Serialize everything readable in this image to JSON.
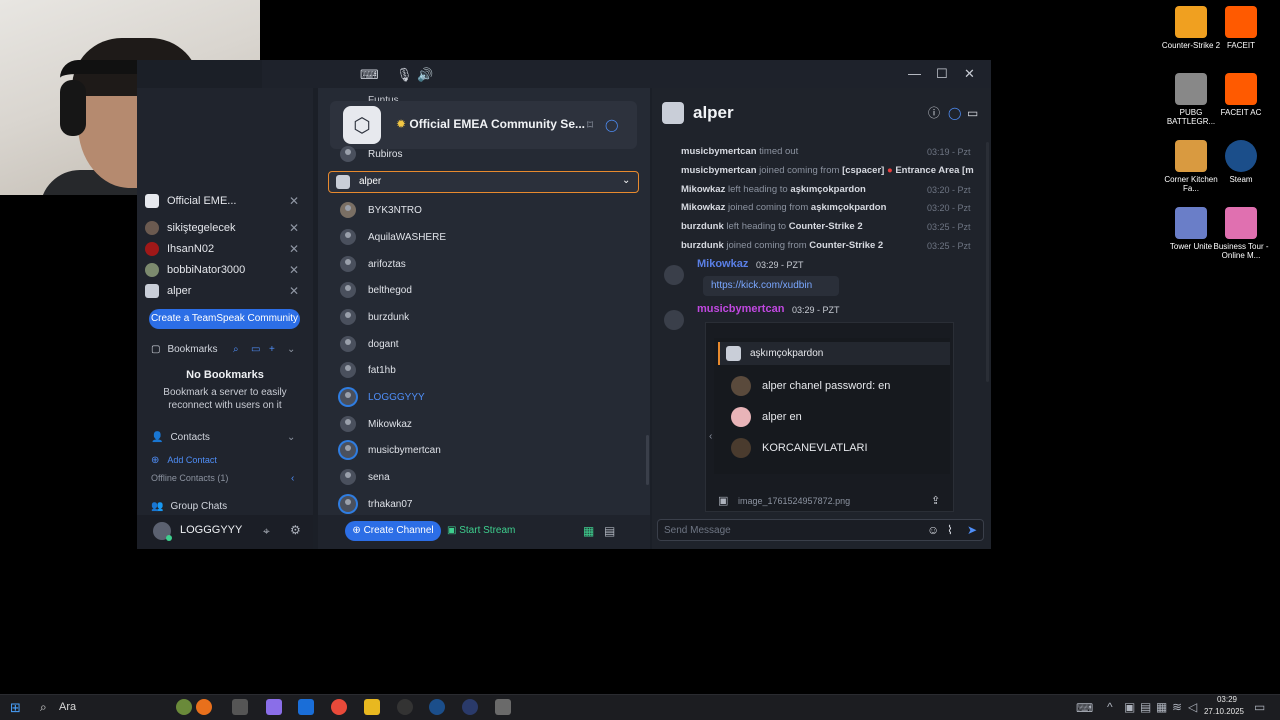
{
  "webcam": {},
  "window": {
    "controls": {
      "minimize": "—",
      "maximize": "☐",
      "close": "✕"
    },
    "toolbar_icons": [
      "keyboard-icon",
      "microphone-icon",
      "speaker-icon"
    ]
  },
  "left": {
    "tabs": [
      {
        "label": "Official EME...",
        "icon": "server-icon"
      },
      {
        "label": "sikiştegelecek",
        "icon": "avatar"
      },
      {
        "label": "IhsanN02",
        "icon": "avatar"
      },
      {
        "label": "bobbiNator3000",
        "icon": "avatar"
      },
      {
        "label": "alper",
        "icon": "server-icon"
      }
    ],
    "create_community": "Create a TeamSpeak Community",
    "bookmarks_label": "Bookmarks",
    "no_bookmarks_title": "No Bookmarks",
    "no_bookmarks_text": "Bookmark a server to easily reconnect with users on it",
    "contacts_label": "Contacts",
    "add_contact": "Add Contact",
    "offline_contacts": "Offline Contacts (1)",
    "group_chats": "Group Chats",
    "current_user": "LOGGGYYY"
  },
  "channels": {
    "server_name": "Official EMEA Community Se...",
    "top_partial": "Funtus",
    "first_user": "Rubiros",
    "selected_channel": "alper",
    "users": [
      "BYK3NTRO",
      "AquilaWASHERE",
      "arifoztas",
      "belthegod",
      "burzdunk",
      "dogant",
      "fat1hb",
      "LOGGGYYY",
      "Mikowkaz",
      "musicbymertcan",
      "sena",
      "trhakan07"
    ],
    "create_channel": "Create Channel",
    "start_stream": "Start Stream"
  },
  "chat": {
    "title": "alper",
    "logs": [
      {
        "user": "musicbymertcan",
        "action": "timed out",
        "extra": "",
        "time": "03:19 - Pzt"
      },
      {
        "user": "musicbymertcan",
        "action": "joined coming from",
        "extra": "[cspacer]",
        "extra2": "Entrance Area [m",
        "time": ""
      },
      {
        "user": "Mikowkaz",
        "action": "left heading to",
        "extra": "aşkımçokpardon",
        "time": "03:20 - Pzt"
      },
      {
        "user": "Mikowkaz",
        "action": "joined coming from",
        "extra": "aşkımçokpardon",
        "time": "03:20 - Pzt"
      },
      {
        "user": "burzdunk",
        "action": "left heading to",
        "extra": "Counter-Strike 2",
        "time": "03:25 - Pzt"
      },
      {
        "user": "burzdunk",
        "action": "joined coming from",
        "extra": "Counter-Strike 2",
        "time": "03:25 - Pzt"
      }
    ],
    "msg1": {
      "author": "Mikowkaz",
      "time": "03:29 - PZT",
      "link": "https://kick.com/xudbin",
      "color": "#5a7fe6"
    },
    "msg2": {
      "author": "musicbymertcan",
      "time": "03:29 - PZT",
      "color": "#c048e0"
    },
    "image": {
      "channel": "aşkımçokpardon",
      "users": [
        "alper chanel password: en",
        "alper en",
        "KORCANEVLATLARI"
      ],
      "filename": "image_1761524957872.png"
    },
    "send_placeholder": "Send Message"
  },
  "desktop": [
    {
      "label": "Counter-Strike 2",
      "color": "#f0a020"
    },
    {
      "label": "FACEIT",
      "color": "#ff5a00"
    },
    {
      "label": "PUBG BATTLEGR...",
      "color": "#888888"
    },
    {
      "label": "FACEIT AC",
      "color": "#ff5a00"
    },
    {
      "label": "Corner Kitchen Fa...",
      "color": "#d99a40"
    },
    {
      "label": "Steam",
      "color": "#1b4e8a"
    },
    {
      "label": "Tower Unite",
      "color": "#6a7ec8"
    },
    {
      "label": "Business Tour - Online M...",
      "color": "#e070b0"
    }
  ],
  "taskbar": {
    "search": "Ara",
    "time": "03:29",
    "date": "27.10.2025"
  }
}
